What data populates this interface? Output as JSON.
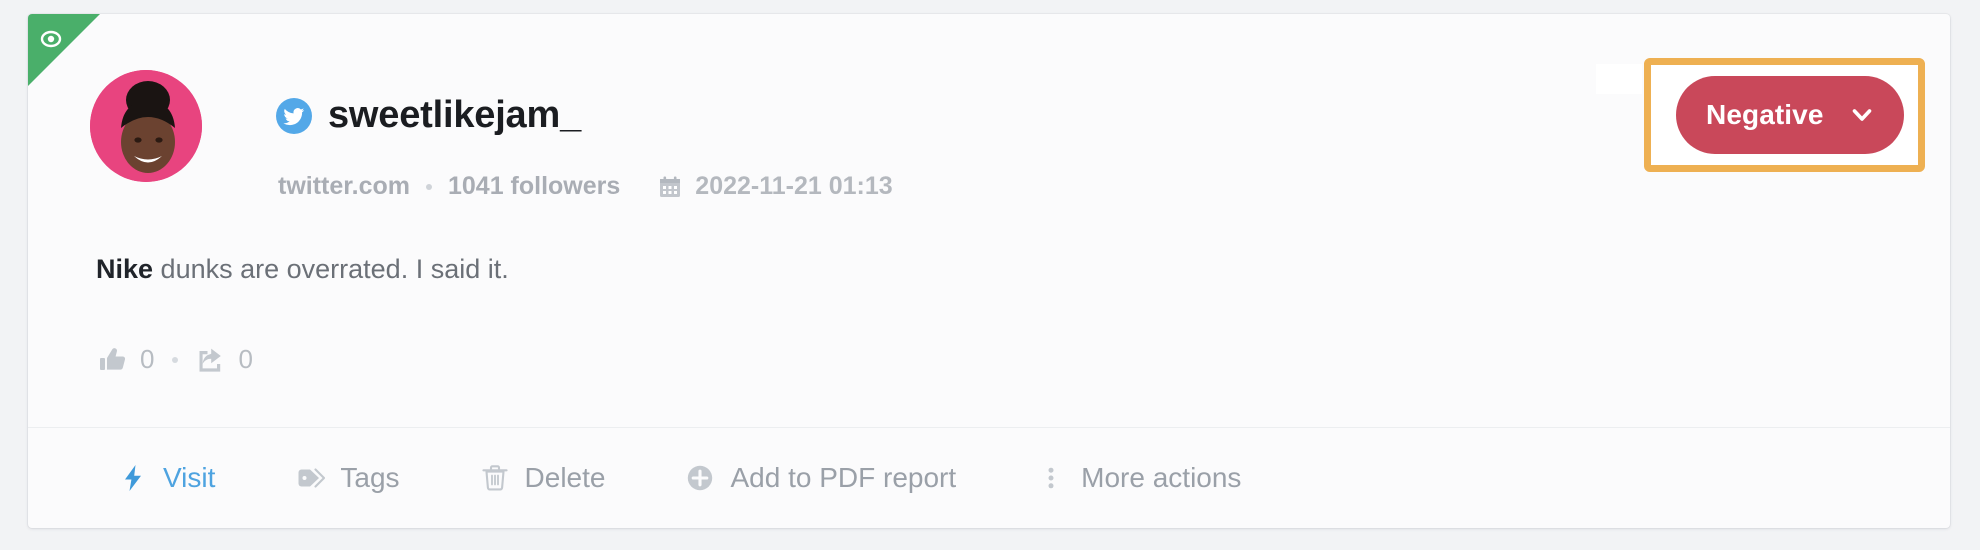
{
  "card": {
    "ribbon": {
      "icon": "eye-icon",
      "color": "#4aaf6a"
    },
    "author": {
      "avatar_icon": "user-avatar",
      "avatar_bg": "#e8447f",
      "network_icon": "twitter-icon",
      "network_color": "#53a8e8",
      "name": "sweetlikejam_"
    },
    "meta": {
      "domain": "twitter.com",
      "followers": "1041 followers",
      "calendar_icon": "calendar-icon",
      "date": "2022-11-21 01:13"
    },
    "sentiment": {
      "label": "Negative",
      "chevron_icon": "chevron-down-icon",
      "badge_color": "#c9485a",
      "highlight_color": "#eeb052"
    },
    "post": {
      "keyword": "Nike",
      "text": " dunks are overrated. I said it."
    },
    "engagement": {
      "likes_icon": "thumbs-up-icon",
      "likes": "0",
      "shares_icon": "share-icon",
      "shares": "0"
    },
    "actions": [
      {
        "label": "Visit",
        "icon": "lightning-bolt-icon",
        "primary": true
      },
      {
        "label": "Tags",
        "icon": "tag-icon",
        "primary": false
      },
      {
        "label": "Delete",
        "icon": "trash-icon",
        "primary": false
      },
      {
        "label": "Add to PDF report",
        "icon": "plus-circle-icon",
        "primary": false
      },
      {
        "label": "More actions",
        "icon": "vertical-dots-icon",
        "primary": false
      }
    ]
  }
}
